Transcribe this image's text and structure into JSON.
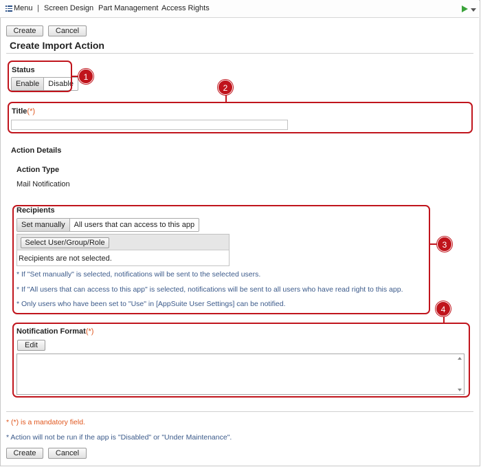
{
  "menubar": {
    "menu_label": "Menu",
    "separator": "|",
    "items": [
      "Screen Design",
      "Part Management",
      "Access Rights"
    ],
    "icons": [
      "hamburger-icon",
      "play-icon",
      "dropdown-icon"
    ],
    "play_color": "#3aa33a"
  },
  "toolbar": {
    "create_label": "Create",
    "cancel_label": "Cancel"
  },
  "page": {
    "title": "Create Import Action"
  },
  "status": {
    "label": "Status",
    "options": [
      "Enable",
      "Disable"
    ],
    "selected": "Enable"
  },
  "title_field": {
    "label": "Title",
    "required_mark": "(*)",
    "value": ""
  },
  "details": {
    "heading": "Action Details",
    "action_type_label": "Action Type",
    "action_type_value": "Mail Notification"
  },
  "recipients": {
    "label": "Recipients",
    "modes": [
      "Set manually",
      "All users that can access to this app"
    ],
    "selected_mode": "Set manually",
    "select_button": "Select User/Group/Role",
    "empty_text": "Recipients are not selected.",
    "notes": [
      "* If \"Set manually\" is selected, notifications will be sent to the selected users.",
      "* If \"All users that can access to this app\" is selected, notifications will be sent to all users who have read right to this app.",
      "* Only users who have been set to \"Use\" in [AppSuite User Settings] can be notified."
    ]
  },
  "notification_format": {
    "label": "Notification Format",
    "required_mark": "(*)",
    "edit_label": "Edit",
    "value": ""
  },
  "footer": {
    "mandatory_note": "* (*) is a mandatory field.",
    "maintenance_note": "* Action will not be run if the app is \"Disabled\" or \"Under Maintenance\"."
  },
  "callouts": [
    "1",
    "2",
    "3",
    "4"
  ],
  "colors": {
    "callout": "#c0141c",
    "required": "#e0561d",
    "note": "#3b5a8a"
  }
}
